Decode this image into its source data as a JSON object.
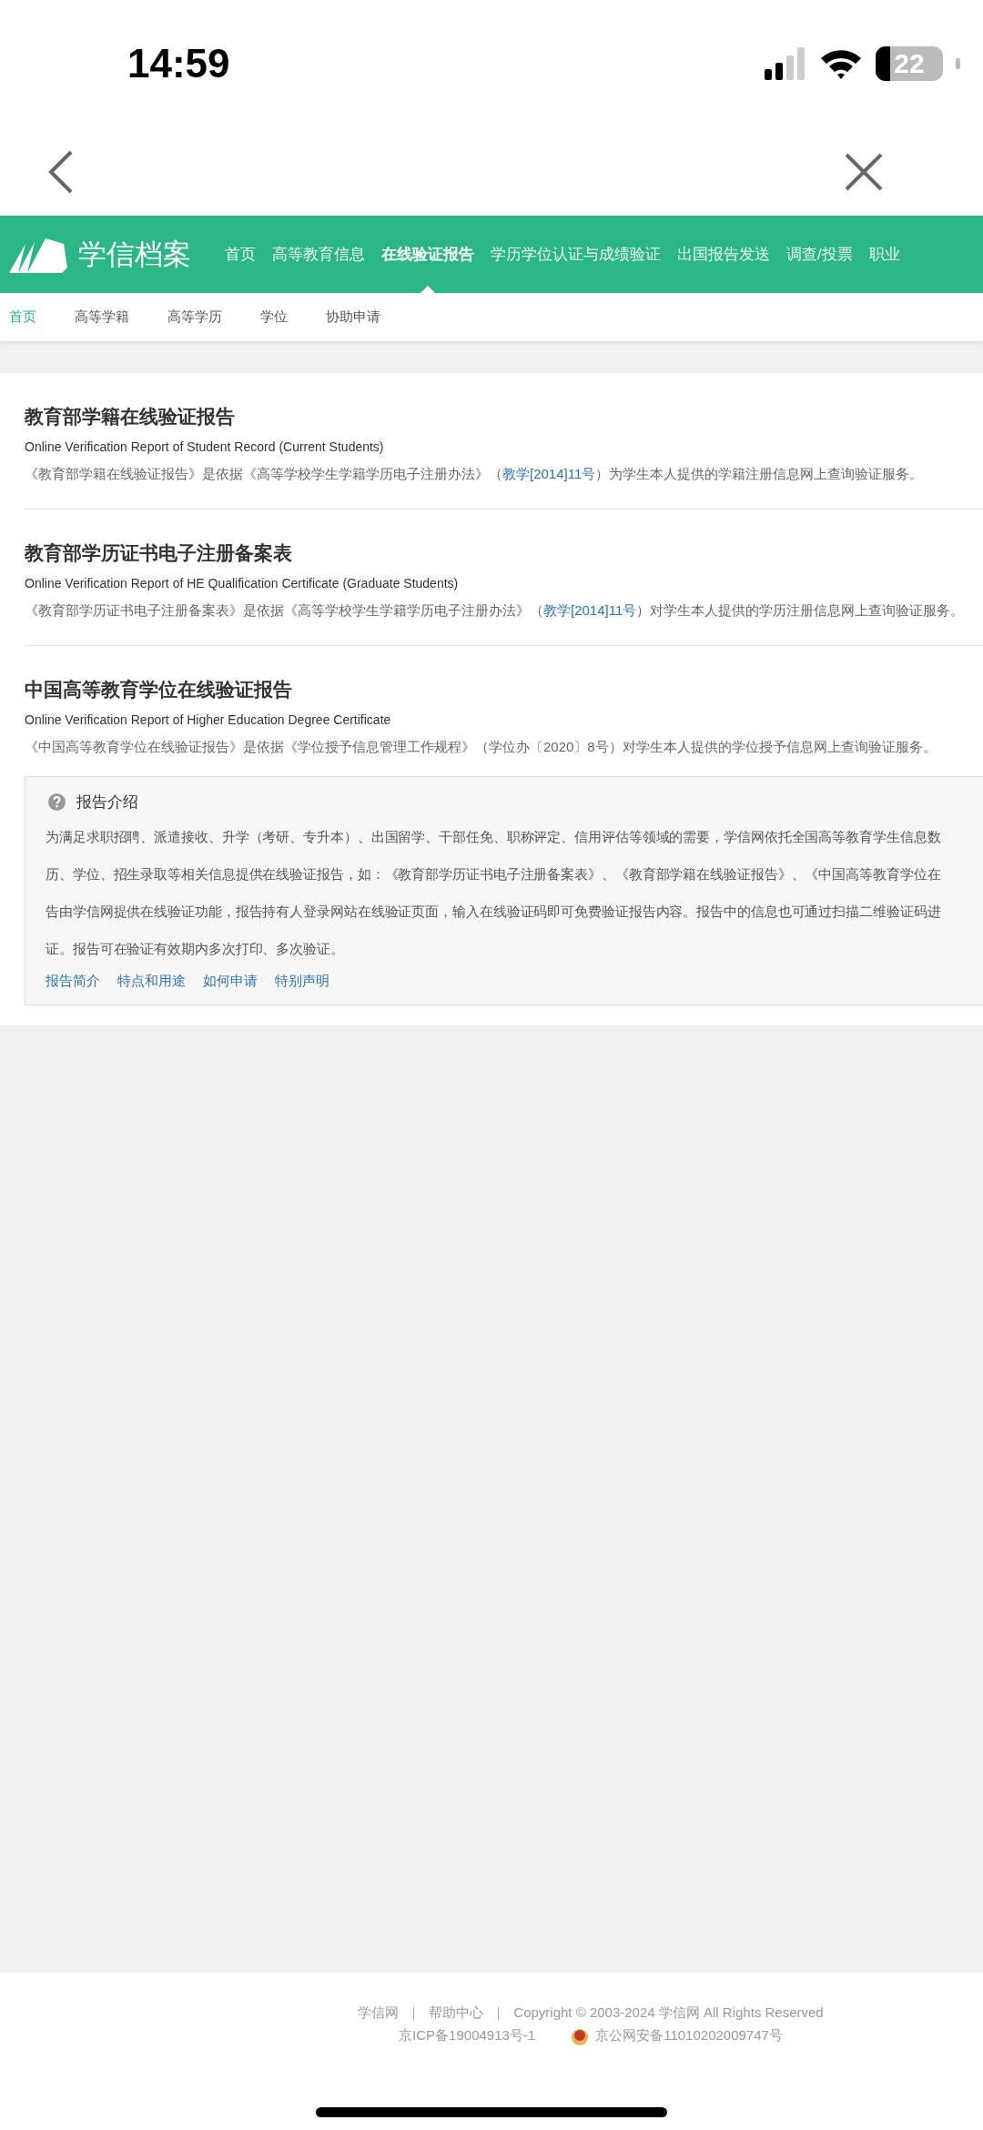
{
  "status_bar": {
    "time": "14:59",
    "battery": "22"
  },
  "site": {
    "logo": "学信档案",
    "nav": [
      {
        "label": "首页",
        "selected": false
      },
      {
        "label": "高等教育信息",
        "selected": false
      },
      {
        "label": "在线验证报告",
        "selected": true
      },
      {
        "label": "学历学位认证与成绩验证",
        "selected": false
      },
      {
        "label": "出国报告发送",
        "selected": false
      },
      {
        "label": "调查/投票",
        "selected": false
      },
      {
        "label": "职业",
        "selected": false
      }
    ]
  },
  "sub_nav": [
    {
      "label": "首页",
      "selected": true
    },
    {
      "label": "高等学籍",
      "selected": false
    },
    {
      "label": "高等学历",
      "selected": false
    },
    {
      "label": "学位",
      "selected": false
    },
    {
      "label": "协助申请",
      "selected": false
    }
  ],
  "reports": [
    {
      "title": "教育部学籍在线验证报告",
      "subtitle": "Online Verification Report of Student Record (Current Students)",
      "description": [
        {
          "text": "《教育部学籍在线验证报告》是依据《高等学校学生学籍学历电子注册办法》（",
          "link": false
        },
        {
          "text": "教学[2014]11号",
          "link": true
        },
        {
          "text": "）为学生本人提供的学籍注册信息网上查询验证服务。",
          "link": false
        }
      ]
    },
    {
      "title": "教育部学历证书电子注册备案表",
      "subtitle": "Online Verification Report of HE Qualification Certificate (Graduate Students)",
      "description": [
        {
          "text": "《教育部学历证书电子注册备案表》是依据《高等学校学生学籍学历电子注册办法》（",
          "link": false
        },
        {
          "text": "教学[2014]11号",
          "link": true
        },
        {
          "text": "）对学生本人提供的学历注册信息网上查询验证服务。",
          "link": false
        }
      ]
    },
    {
      "title": "中国高等教育学位在线验证报告",
      "subtitle": "Online Verification Report of Higher Education Degree Certificate",
      "description": [
        {
          "text": "《中国高等教育学位在线验证报告》是依据《学位授予信息管理工作规程》（学位办〔2020〕8号）对学生本人提供的学位授予信息网上查询验证服务。",
          "link": false
        }
      ]
    }
  ],
  "intro": {
    "title": "报告介绍",
    "lines": [
      "为满足求职招聘、派遣接收、升学（考研、专升本）、出国留学、干部任免、职称评定、信用评估等领域的需要，学信网依托全国高等教育学生信息数",
      "历、学位、招生录取等相关信息提供在线验证报告，如：《教育部学历证书电子注册备案表》、《教育部学籍在线验证报告》、《中国高等教育学位在",
      "告由学信网提供在线验证功能，报告持有人登录网站在线验证页面，输入在线验证码即可免费验证报告内容。报告中的信息也可通过扫描二维验证码进",
      "证。报告可在验证有效期内多次打印、多次验证。"
    ],
    "links": [
      "报告简介",
      "特点和用途",
      "如何申请",
      "特别声明"
    ]
  },
  "footer": {
    "links": [
      "学信网",
      "帮助中心"
    ],
    "copyright": "Copyright © 2003-2024 学信网 All Rights Reserved",
    "icp": "京ICP备19004913号-1",
    "police": "京公网安备11010202009747号"
  }
}
